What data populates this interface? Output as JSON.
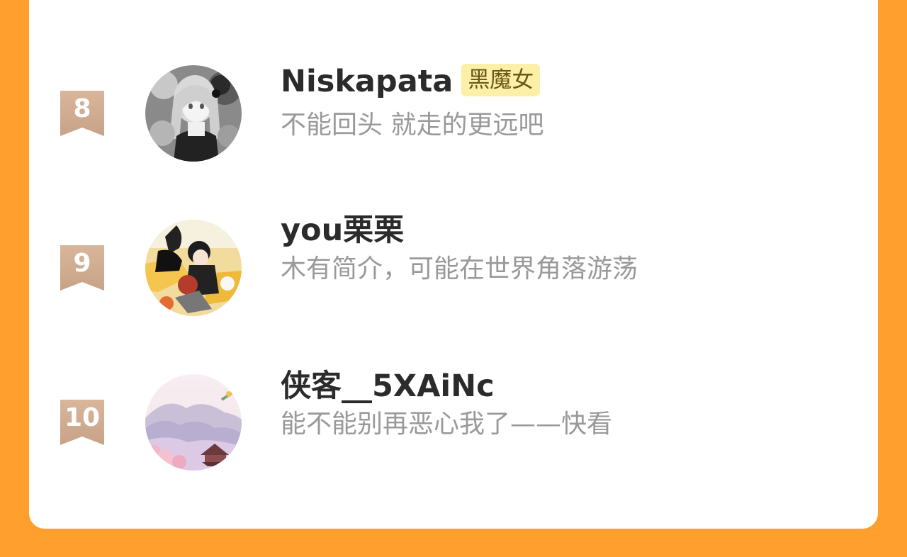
{
  "rows": [
    {
      "rank": "8",
      "name": "Niskapata",
      "tag": "黑魔女",
      "bio": "不能回头 就走的更远吧",
      "avatar_icon": "gothic-doll-avatar"
    },
    {
      "rank": "9",
      "name": "you栗栗",
      "tag": "",
      "bio": "木有简介，可能在世界角落游荡",
      "avatar_icon": "anime-boy-avatar"
    },
    {
      "rank": "10",
      "name": "侠客__5XAiNc",
      "tag": "",
      "bio": "能不能别再恶心我了——快看",
      "avatar_icon": "chinese-landscape-avatar"
    }
  ],
  "colors": {
    "page_background": "#ff9f2e",
    "card_background": "#ffffff",
    "badge_gradient_start": "#d9b69b",
    "badge_gradient_end": "#c8a489",
    "tag_background": "#fcefa7",
    "name_text": "#2b2b2b",
    "bio_text": "#999999"
  }
}
